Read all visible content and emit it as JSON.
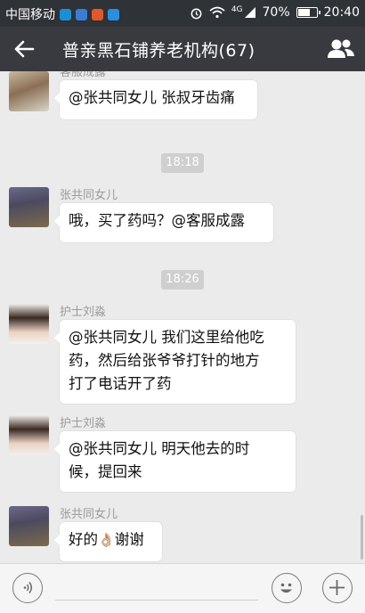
{
  "status_bar": {
    "carrier": "中国移动",
    "network": "4G",
    "battery": "70%",
    "battery_level": 0.7,
    "time": "20:40",
    "app_icon_colors": [
      "#1a8fd6",
      "#3a7bd5",
      "#e0592a",
      "#2b8ee0"
    ]
  },
  "header": {
    "title": "普亲黑石铺养老机构(67)",
    "back_icon": "back-arrow-icon",
    "members_icon": "group-members-icon"
  },
  "messages": [
    {
      "sender": "客服成露",
      "text": "@张共同女儿 张叔牙齿痛"
    },
    {
      "time": "18:18"
    },
    {
      "sender": "张共同女儿",
      "text": "哦，买了药吗？@客服成露"
    },
    {
      "time": "18:26"
    },
    {
      "sender": "护士刘淼",
      "lines": [
        "@张共同女儿 我们这里给他吃",
        "药，然后给张爷爷打针的地方",
        "打了电话开了药"
      ]
    },
    {
      "sender": "护士刘淼",
      "lines": [
        "@张共同女儿 明天他去的时",
        "候，提回来"
      ]
    },
    {
      "sender": "张共同女儿",
      "text_before": "好的",
      "emoji": "👌🏼",
      "text_after": "谢谢"
    }
  ],
  "input_bar": {
    "voice_icon": "voice-icon",
    "emoji_icon": "emoji-icon",
    "plus_icon": "plus-icon"
  },
  "colors": {
    "status_bar_bg": "#2f3237",
    "header_bg": "#393a3f",
    "chat_bg": "#ebebeb",
    "bubble_bg": "#ffffff"
  }
}
